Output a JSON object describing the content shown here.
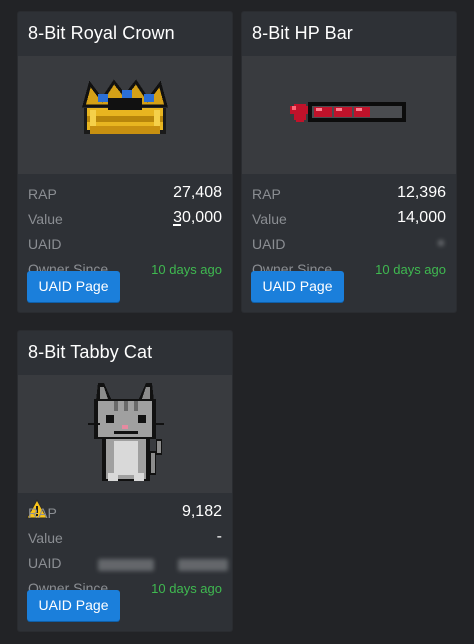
{
  "items": [
    {
      "title": "8-Bit Royal Crown",
      "rap_label": "RAP",
      "rap": "27,408",
      "value_label": "Value",
      "value": "30,000",
      "uaid_label": "UAID",
      "uaid": "",
      "owner_label": "Owner Since",
      "owner": "10 days ago",
      "button": "UAID Page",
      "icon": "crown-thumbnail"
    },
    {
      "title": "8-Bit HP Bar",
      "rap_label": "RAP",
      "rap": "12,396",
      "value_label": "Value",
      "value": "14,000",
      "uaid_label": "UAID",
      "uaid": "",
      "owner_label": "Owner Since",
      "owner": "10 days ago",
      "button": "UAID Page",
      "icon": "hp-bar-thumbnail"
    },
    {
      "title": "8-Bit Tabby Cat",
      "rap_label": "RAP",
      "rap": "9,182",
      "value_label": "Value",
      "value": "-",
      "uaid_label": "UAID",
      "uaid": "",
      "owner_label": "Owner Since",
      "owner": "10 days ago",
      "button": "UAID Page",
      "icon": "tabby-cat-thumbnail",
      "warning_icon": "warning-icon"
    }
  ],
  "colors": {
    "background": "#222326",
    "card": "#2e3136",
    "thumbnail": "#393b3f",
    "label": "#8b8e93",
    "owner_text": "#3fb950",
    "button": "#1b7fdb"
  }
}
